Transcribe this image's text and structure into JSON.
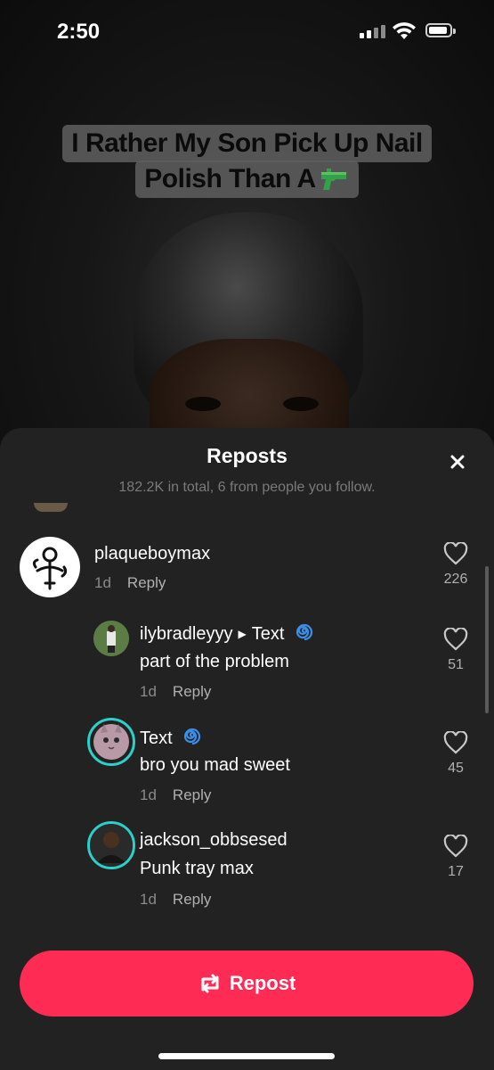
{
  "status": {
    "time": "2:50"
  },
  "video": {
    "caption_line1": "I Rather My Son Pick Up Nail",
    "caption_line2": "Polish Than A",
    "caption_icon": "water-pistol-icon"
  },
  "sheet": {
    "title": "Reposts",
    "subtitle": "182.2K in total, 6 from people you follow.",
    "close_icon": "close-icon"
  },
  "comments": [
    {
      "username": "plaqueboymax",
      "text": "",
      "age": "1d",
      "reply": "Reply",
      "likes": "226"
    },
    {
      "username": "ilybradleyyy",
      "reply_to": "Text",
      "text": "part of the problem",
      "age": "1d",
      "reply": "Reply",
      "likes": "51"
    },
    {
      "username": "Text",
      "text": "bro you mad sweet",
      "age": "1d",
      "reply": "Reply",
      "likes": "45"
    },
    {
      "username": "jackson_obbsesed",
      "text": "Punk tray max",
      "age": "1d",
      "reply": "Reply",
      "likes": "17"
    }
  ],
  "repost_button": {
    "label": "Repost",
    "icon": "repost-icon"
  },
  "colors": {
    "accent": "#fe2c55",
    "sheet_bg": "#222222",
    "ring": "#2ad1c9"
  }
}
